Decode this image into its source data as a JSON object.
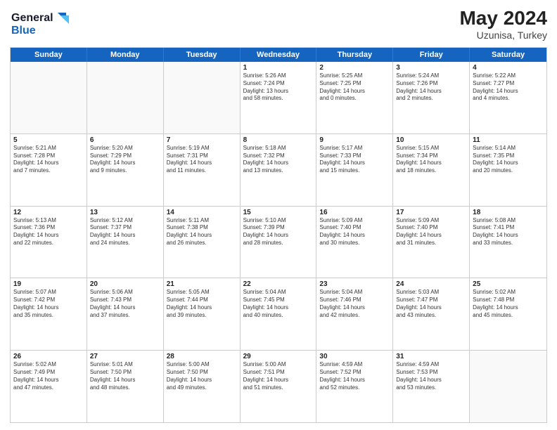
{
  "header": {
    "logo_line1": "General",
    "logo_line2": "Blue",
    "month_year": "May 2024",
    "location": "Uzunisa, Turkey"
  },
  "weekdays": [
    "Sunday",
    "Monday",
    "Tuesday",
    "Wednesday",
    "Thursday",
    "Friday",
    "Saturday"
  ],
  "rows": [
    [
      {
        "day": "",
        "info": ""
      },
      {
        "day": "",
        "info": ""
      },
      {
        "day": "",
        "info": ""
      },
      {
        "day": "1",
        "info": "Sunrise: 5:26 AM\nSunset: 7:24 PM\nDaylight: 13 hours\nand 58 minutes."
      },
      {
        "day": "2",
        "info": "Sunrise: 5:25 AM\nSunset: 7:25 PM\nDaylight: 14 hours\nand 0 minutes."
      },
      {
        "day": "3",
        "info": "Sunrise: 5:24 AM\nSunset: 7:26 PM\nDaylight: 14 hours\nand 2 minutes."
      },
      {
        "day": "4",
        "info": "Sunrise: 5:22 AM\nSunset: 7:27 PM\nDaylight: 14 hours\nand 4 minutes."
      }
    ],
    [
      {
        "day": "5",
        "info": "Sunrise: 5:21 AM\nSunset: 7:28 PM\nDaylight: 14 hours\nand 7 minutes."
      },
      {
        "day": "6",
        "info": "Sunrise: 5:20 AM\nSunset: 7:29 PM\nDaylight: 14 hours\nand 9 minutes."
      },
      {
        "day": "7",
        "info": "Sunrise: 5:19 AM\nSunset: 7:31 PM\nDaylight: 14 hours\nand 11 minutes."
      },
      {
        "day": "8",
        "info": "Sunrise: 5:18 AM\nSunset: 7:32 PM\nDaylight: 14 hours\nand 13 minutes."
      },
      {
        "day": "9",
        "info": "Sunrise: 5:17 AM\nSunset: 7:33 PM\nDaylight: 14 hours\nand 15 minutes."
      },
      {
        "day": "10",
        "info": "Sunrise: 5:15 AM\nSunset: 7:34 PM\nDaylight: 14 hours\nand 18 minutes."
      },
      {
        "day": "11",
        "info": "Sunrise: 5:14 AM\nSunset: 7:35 PM\nDaylight: 14 hours\nand 20 minutes."
      }
    ],
    [
      {
        "day": "12",
        "info": "Sunrise: 5:13 AM\nSunset: 7:36 PM\nDaylight: 14 hours\nand 22 minutes."
      },
      {
        "day": "13",
        "info": "Sunrise: 5:12 AM\nSunset: 7:37 PM\nDaylight: 14 hours\nand 24 minutes."
      },
      {
        "day": "14",
        "info": "Sunrise: 5:11 AM\nSunset: 7:38 PM\nDaylight: 14 hours\nand 26 minutes."
      },
      {
        "day": "15",
        "info": "Sunrise: 5:10 AM\nSunset: 7:39 PM\nDaylight: 14 hours\nand 28 minutes."
      },
      {
        "day": "16",
        "info": "Sunrise: 5:09 AM\nSunset: 7:40 PM\nDaylight: 14 hours\nand 30 minutes."
      },
      {
        "day": "17",
        "info": "Sunrise: 5:09 AM\nSunset: 7:40 PM\nDaylight: 14 hours\nand 31 minutes."
      },
      {
        "day": "18",
        "info": "Sunrise: 5:08 AM\nSunset: 7:41 PM\nDaylight: 14 hours\nand 33 minutes."
      }
    ],
    [
      {
        "day": "19",
        "info": "Sunrise: 5:07 AM\nSunset: 7:42 PM\nDaylight: 14 hours\nand 35 minutes."
      },
      {
        "day": "20",
        "info": "Sunrise: 5:06 AM\nSunset: 7:43 PM\nDaylight: 14 hours\nand 37 minutes."
      },
      {
        "day": "21",
        "info": "Sunrise: 5:05 AM\nSunset: 7:44 PM\nDaylight: 14 hours\nand 39 minutes."
      },
      {
        "day": "22",
        "info": "Sunrise: 5:04 AM\nSunset: 7:45 PM\nDaylight: 14 hours\nand 40 minutes."
      },
      {
        "day": "23",
        "info": "Sunrise: 5:04 AM\nSunset: 7:46 PM\nDaylight: 14 hours\nand 42 minutes."
      },
      {
        "day": "24",
        "info": "Sunrise: 5:03 AM\nSunset: 7:47 PM\nDaylight: 14 hours\nand 43 minutes."
      },
      {
        "day": "25",
        "info": "Sunrise: 5:02 AM\nSunset: 7:48 PM\nDaylight: 14 hours\nand 45 minutes."
      }
    ],
    [
      {
        "day": "26",
        "info": "Sunrise: 5:02 AM\nSunset: 7:49 PM\nDaylight: 14 hours\nand 47 minutes."
      },
      {
        "day": "27",
        "info": "Sunrise: 5:01 AM\nSunset: 7:50 PM\nDaylight: 14 hours\nand 48 minutes."
      },
      {
        "day": "28",
        "info": "Sunrise: 5:00 AM\nSunset: 7:50 PM\nDaylight: 14 hours\nand 49 minutes."
      },
      {
        "day": "29",
        "info": "Sunrise: 5:00 AM\nSunset: 7:51 PM\nDaylight: 14 hours\nand 51 minutes."
      },
      {
        "day": "30",
        "info": "Sunrise: 4:59 AM\nSunset: 7:52 PM\nDaylight: 14 hours\nand 52 minutes."
      },
      {
        "day": "31",
        "info": "Sunrise: 4:59 AM\nSunset: 7:53 PM\nDaylight: 14 hours\nand 53 minutes."
      },
      {
        "day": "",
        "info": ""
      }
    ]
  ]
}
